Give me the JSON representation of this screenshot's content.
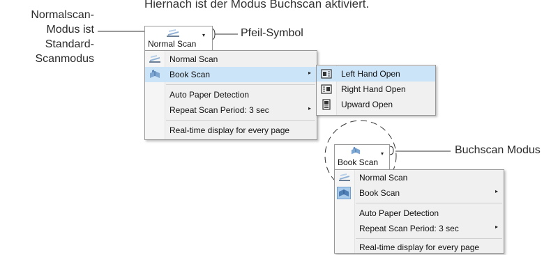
{
  "caption": "Hiernach ist der Modus Buchscan aktiviert.",
  "side_label": {
    "line1": "Normalscan-",
    "line2": "Modus ist",
    "line3": "Standard-",
    "line4": "Scanmodus"
  },
  "callouts": {
    "arrow_symbol": "Pfeil-Symbol",
    "book_mode": "Buchscan Modus"
  },
  "top_button": {
    "label": "Normal Scan",
    "icon": "normal-scan-icon",
    "arrow": "▾"
  },
  "bottom_button": {
    "label": "Book Scan",
    "icon": "book-scan-icon",
    "arrow": "▾"
  },
  "menu_top": {
    "items": [
      {
        "label": "Normal Scan",
        "icon": "normal-scan-icon"
      },
      {
        "label": "Book Scan",
        "icon": "book-scan-icon",
        "submenu": "▸",
        "highlighted": true
      },
      {
        "label": "Auto Paper Detection"
      },
      {
        "label": "Repeat Scan Period:  3 sec",
        "submenu": "▸"
      },
      {
        "label": "Real-time display for every page"
      }
    ]
  },
  "submenu_top": {
    "items": [
      {
        "label": "Left Hand Open",
        "icon": "left-hand-open-icon",
        "highlighted": true
      },
      {
        "label": "Right Hand Open",
        "icon": "right-hand-open-icon"
      },
      {
        "label": "Upward Open",
        "icon": "upward-open-icon"
      }
    ]
  },
  "menu_bottom": {
    "items": [
      {
        "label": "Normal Scan",
        "icon": "normal-scan-icon"
      },
      {
        "label": "Book Scan",
        "icon": "book-scan-icon",
        "submenu": "▸",
        "selected": true
      },
      {
        "label": "Auto Paper Detection"
      },
      {
        "label": "Repeat Scan Period:  3 sec",
        "submenu": "▸"
      },
      {
        "label": "Real-time display for every page"
      }
    ]
  },
  "colors": {
    "highlight": "#cce4f7",
    "selected_icon_bg": "#a8cbec",
    "menu_bg": "#f0f0f0"
  }
}
